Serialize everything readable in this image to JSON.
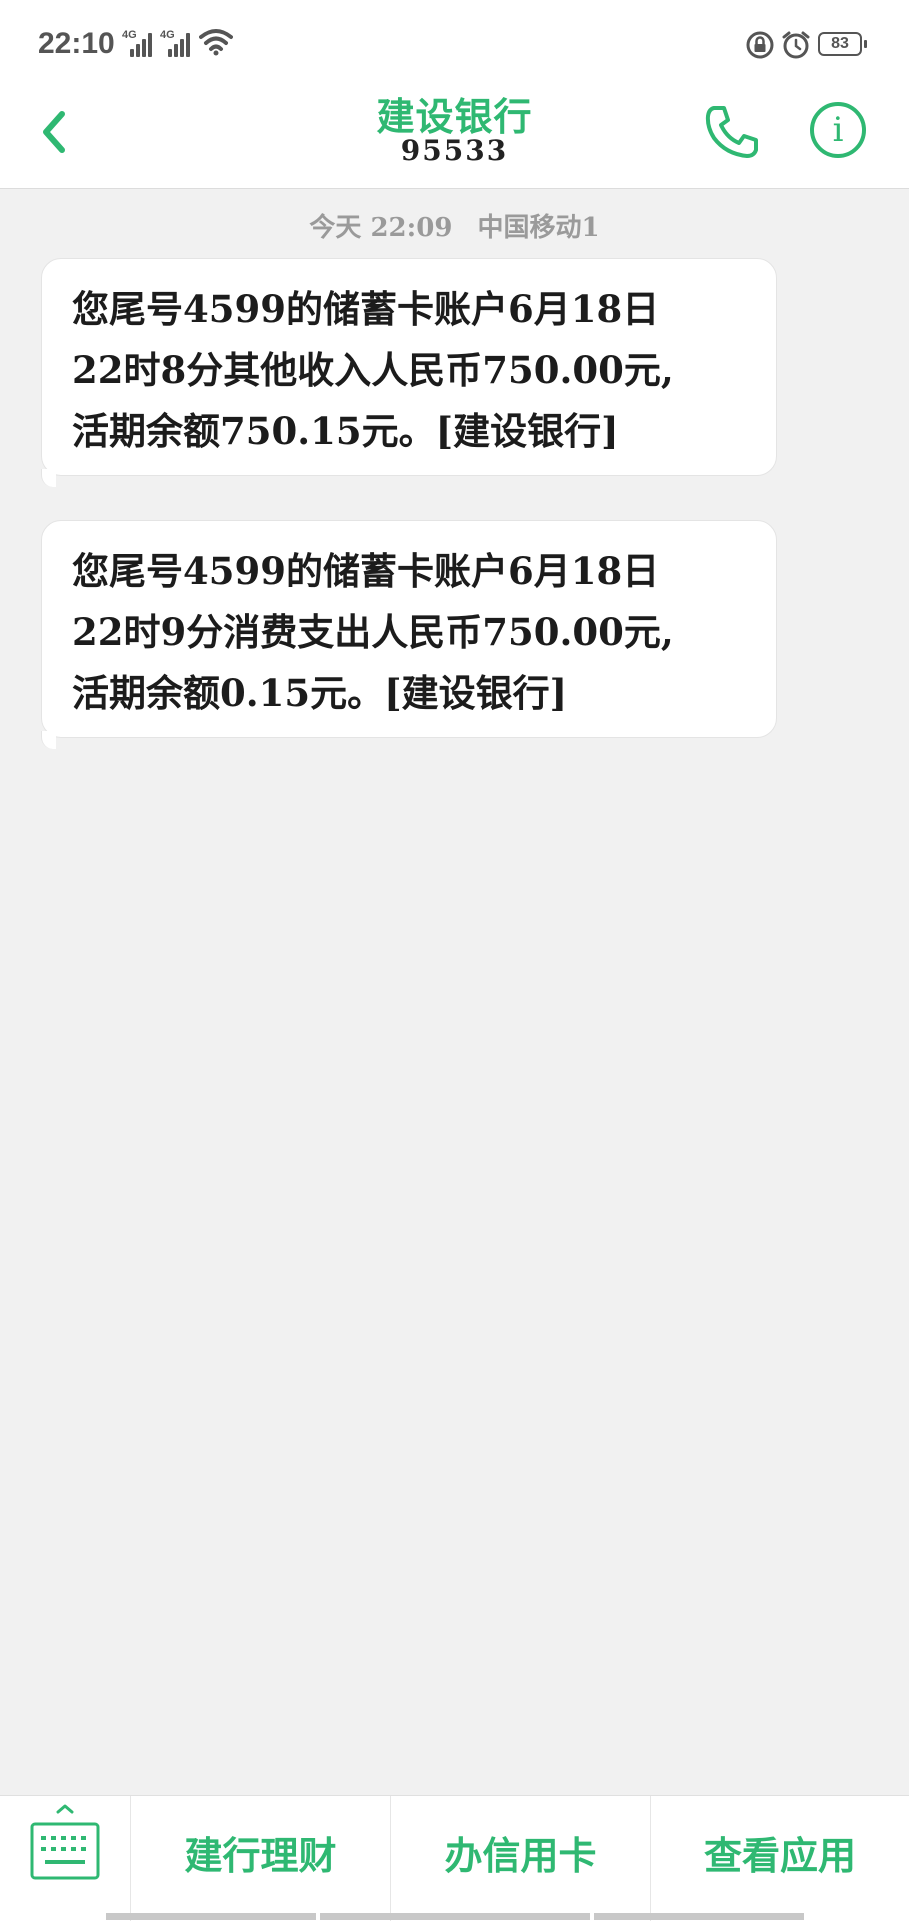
{
  "status_bar": {
    "time": "22:10",
    "network1": "4G",
    "network2": "4G",
    "battery": "83",
    "icons": [
      "signal-icon",
      "wifi-icon",
      "lock-icon",
      "alarm-icon",
      "battery-icon"
    ]
  },
  "header": {
    "contact_name": "建设银行",
    "contact_number": "95533",
    "accent_color": "#2fb872"
  },
  "conversation": {
    "meta_day": "今天 22:09",
    "meta_sim": "中国移动1",
    "messages": [
      {
        "lines": [
          "您尾号4599的储蓄卡账户6月18日",
          "22时8分其他收入人民币750.00元,",
          "活期余额750.15元。[建设银行]"
        ]
      },
      {
        "lines": [
          "您尾号4599的储蓄卡账户6月18日",
          "22时9分消费支出人民币750.00元,",
          "活期余额0.15元。[建设银行]"
        ]
      }
    ]
  },
  "bottom_menu": {
    "items": [
      "建行理财",
      "办信用卡",
      "查看应用"
    ]
  }
}
